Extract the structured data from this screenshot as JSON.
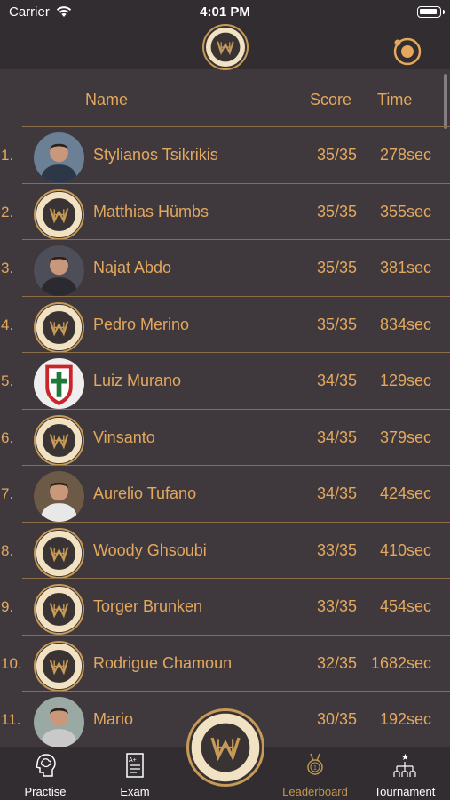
{
  "status_bar": {
    "carrier": "Carrier",
    "time": "4:01 PM"
  },
  "header": {
    "logo_icon": "habanos-world-challenge-logo",
    "settings_icon": "orbit-icon"
  },
  "table": {
    "columns": {
      "name": "Name",
      "score": "Score",
      "time": "Time"
    },
    "rows": [
      {
        "rank": "1.",
        "name": "Stylianos Tsikrikis",
        "score": "35/35",
        "time": "278sec",
        "avatar": "photo"
      },
      {
        "rank": "2.",
        "name": "Matthias Hümbs",
        "score": "35/35",
        "time": "355sec",
        "avatar": "logo"
      },
      {
        "rank": "3.",
        "name": "Najat Abdo",
        "score": "35/35",
        "time": "381sec",
        "avatar": "photo"
      },
      {
        "rank": "4.",
        "name": "Pedro Merino",
        "score": "35/35",
        "time": "834sec",
        "avatar": "logo"
      },
      {
        "rank": "5.",
        "name": "Luiz Murano",
        "score": "34/35",
        "time": "129sec",
        "avatar": "crest"
      },
      {
        "rank": "6.",
        "name": "Vinsanto",
        "score": "34/35",
        "time": "379sec",
        "avatar": "logo"
      },
      {
        "rank": "7.",
        "name": "Aurelio Tufano",
        "score": "34/35",
        "time": "424sec",
        "avatar": "photo"
      },
      {
        "rank": "8.",
        "name": "Woody Ghsoubi",
        "score": "33/35",
        "time": "410sec",
        "avatar": "logo"
      },
      {
        "rank": "9.",
        "name": "Torger Brunken",
        "score": "33/35",
        "time": "454sec",
        "avatar": "logo"
      },
      {
        "rank": "10.",
        "name": "Rodrigue Chamoun",
        "score": "32/35",
        "time": "1682sec",
        "avatar": "logo"
      },
      {
        "rank": "11.",
        "name": "Mario",
        "score": "30/35",
        "time": "192sec",
        "avatar": "photo"
      }
    ]
  },
  "tabbar": {
    "tabs": [
      {
        "label": "Practise",
        "icon": "brain-head-icon",
        "active": false
      },
      {
        "label": "Exam",
        "icon": "exam-sheet-icon",
        "active": false
      },
      {
        "label": "Leaderboard",
        "icon": "medal-icon",
        "active": true
      },
      {
        "label": "Tournament",
        "icon": "tournament-bracket-icon",
        "active": false
      }
    ],
    "center_logo": "habanos-world-challenge-logo"
  },
  "colors": {
    "accent": "#e3a85e",
    "background": "#3f393d",
    "bar": "#312d30",
    "divider": "#8c6f48"
  }
}
